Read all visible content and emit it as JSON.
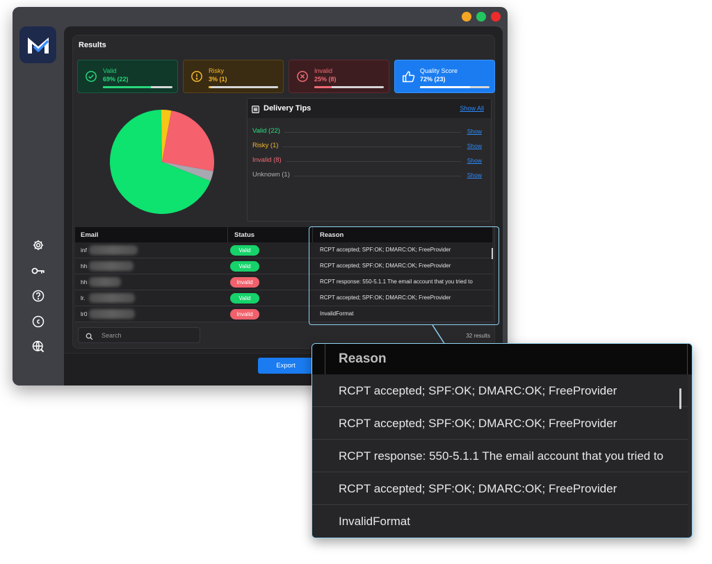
{
  "window": {
    "traffic_colors": [
      "#f5a524",
      "#22c55e",
      "#ef2b2b"
    ]
  },
  "sidebar": {
    "logo_icon": "mail-check-logo",
    "icons": [
      "gear-icon",
      "key-icon",
      "help-icon",
      "credits-icon",
      "globe-icon"
    ]
  },
  "results": {
    "title": "Results",
    "cards": [
      {
        "label": "Valid",
        "value": "69% (22)",
        "percent": 69,
        "color": "#28d77a",
        "bg": "#10392a",
        "border": "#1d5a3e",
        "icon": "check-circle-icon"
      },
      {
        "label": "Risky",
        "value": "3% (1)",
        "percent": 3,
        "color": "#f5b82e",
        "bg": "#3a2c12",
        "border": "#5a4318",
        "icon": "warning-circle-icon"
      },
      {
        "label": "Invalid",
        "value": "25% (8)",
        "percent": 25,
        "color": "#f06b75",
        "bg": "#3d1d20",
        "border": "#5d2a2f",
        "icon": "x-circle-icon"
      },
      {
        "label": "Quality Score",
        "value": "72% (23)",
        "percent": 72,
        "color": "#ffffff",
        "bg": "#1a7cf0",
        "border": "#3a94ff",
        "icon": "thumbs-up-icon"
      }
    ],
    "pie": {
      "slices": [
        {
          "name": "Valid",
          "value": 22,
          "color": "#0ee26f"
        },
        {
          "name": "Risky",
          "value": 1,
          "color": "#f5c518"
        },
        {
          "name": "Invalid",
          "value": 8,
          "color": "#f5616d"
        },
        {
          "name": "Unknown",
          "value": 1,
          "color": "#a8a8b0"
        }
      ]
    },
    "tips": {
      "title": "Delivery Tips",
      "show_all": "Show All",
      "items": [
        {
          "label": "Valid (22)",
          "color": "#2ee07f",
          "link": "Show"
        },
        {
          "label": "Risky (1)",
          "color": "#f5b82e",
          "link": "Show"
        },
        {
          "label": "Invalid (8)",
          "color": "#f06b75",
          "link": "Show"
        },
        {
          "label": "Unknown (1)",
          "color": "#b0b0b0",
          "link": "Show"
        }
      ]
    },
    "table": {
      "headers": [
        "Email",
        "Status",
        "Reason"
      ],
      "rows": [
        {
          "email": "inf",
          "status": "Valid",
          "reason": "RCPT accepted; SPF:OK; DMARC:OK; FreeProvider"
        },
        {
          "email": "hh",
          "status": "Valid",
          "reason": "RCPT accepted; SPF:OK; DMARC:OK; FreeProvider"
        },
        {
          "email": "hh",
          "status": "Invalid",
          "reason": "RCPT response: 550-5.1.1 The email account that you tried to"
        },
        {
          "email": "lr.",
          "status": "Valid",
          "reason": "RCPT accepted; SPF:OK; DMARC:OK; FreeProvider"
        },
        {
          "email": "lr0",
          "status": "Invalid",
          "reason": "InvalidFormat"
        }
      ]
    },
    "search": {
      "placeholder": "Search"
    },
    "count": "32 results",
    "export": "Export"
  },
  "zoom": {
    "header": "Reason",
    "rows": [
      "RCPT accepted; SPF:OK; DMARC:OK; FreeProvider",
      "RCPT accepted; SPF:OK; DMARC:OK; FreeProvider",
      "RCPT response: 550-5.1.1 The email account that you tried to",
      "RCPT accepted; SPF:OK; DMARC:OK; FreeProvider",
      "InvalidFormat"
    ]
  }
}
